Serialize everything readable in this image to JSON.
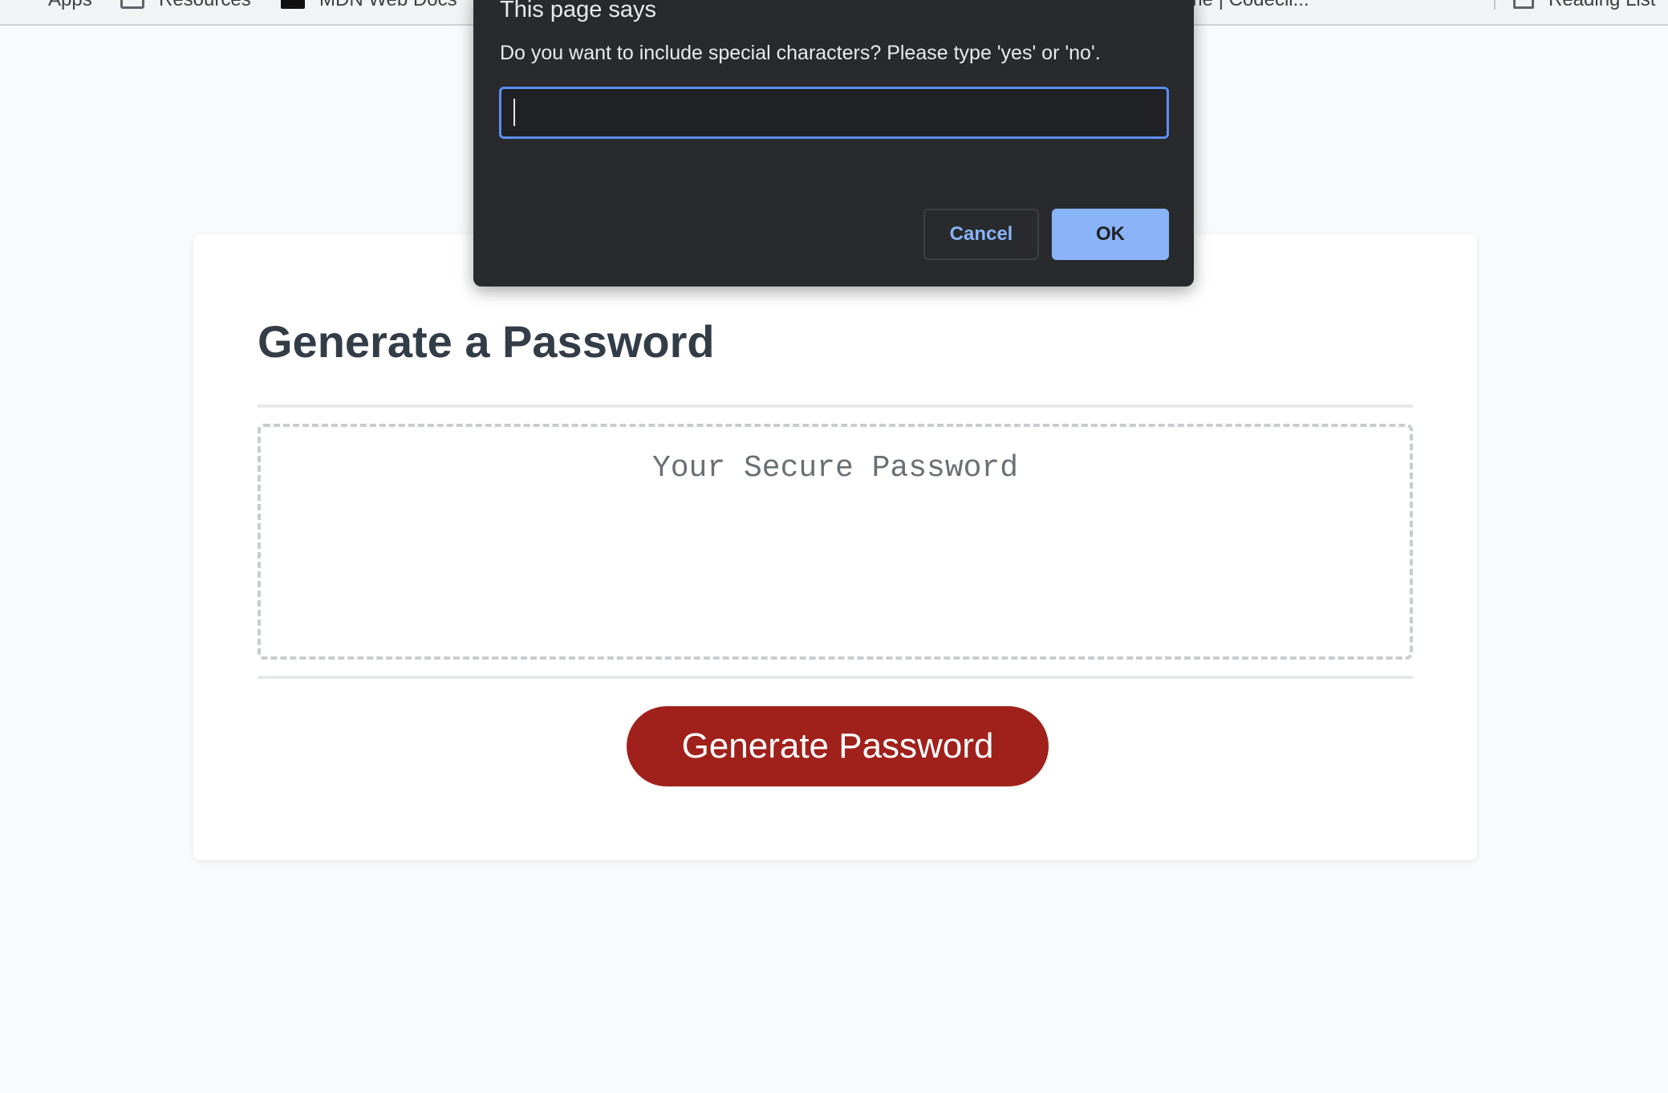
{
  "bookmarks": {
    "items": [
      {
        "label": "Apps",
        "icon": "apps-icon"
      },
      {
        "label": "Resources",
        "icon": "folder-icon"
      },
      {
        "label": "MDN Web Docs",
        "icon": "mdn-icon"
      },
      {
        "label": "Home | Codecli...",
        "icon": ""
      }
    ],
    "reading_list": {
      "label": "Reading List",
      "icon": "reading-list-icon"
    }
  },
  "dialog": {
    "title": "This page says",
    "message": "Do you want to include special characters? Please type 'yes' or 'no'.",
    "input_value": "",
    "cancel_label": "Cancel",
    "ok_label": "OK",
    "colors": {
      "background": "#282a2e",
      "accent": "#8ab4f8",
      "focus_border": "#5b8ef0"
    }
  },
  "card": {
    "title": "Generate a Password",
    "password_placeholder": "Your Secure Password",
    "generate_label": "Generate Password",
    "colors": {
      "button": "#a0211b",
      "title": "#333d47"
    }
  }
}
